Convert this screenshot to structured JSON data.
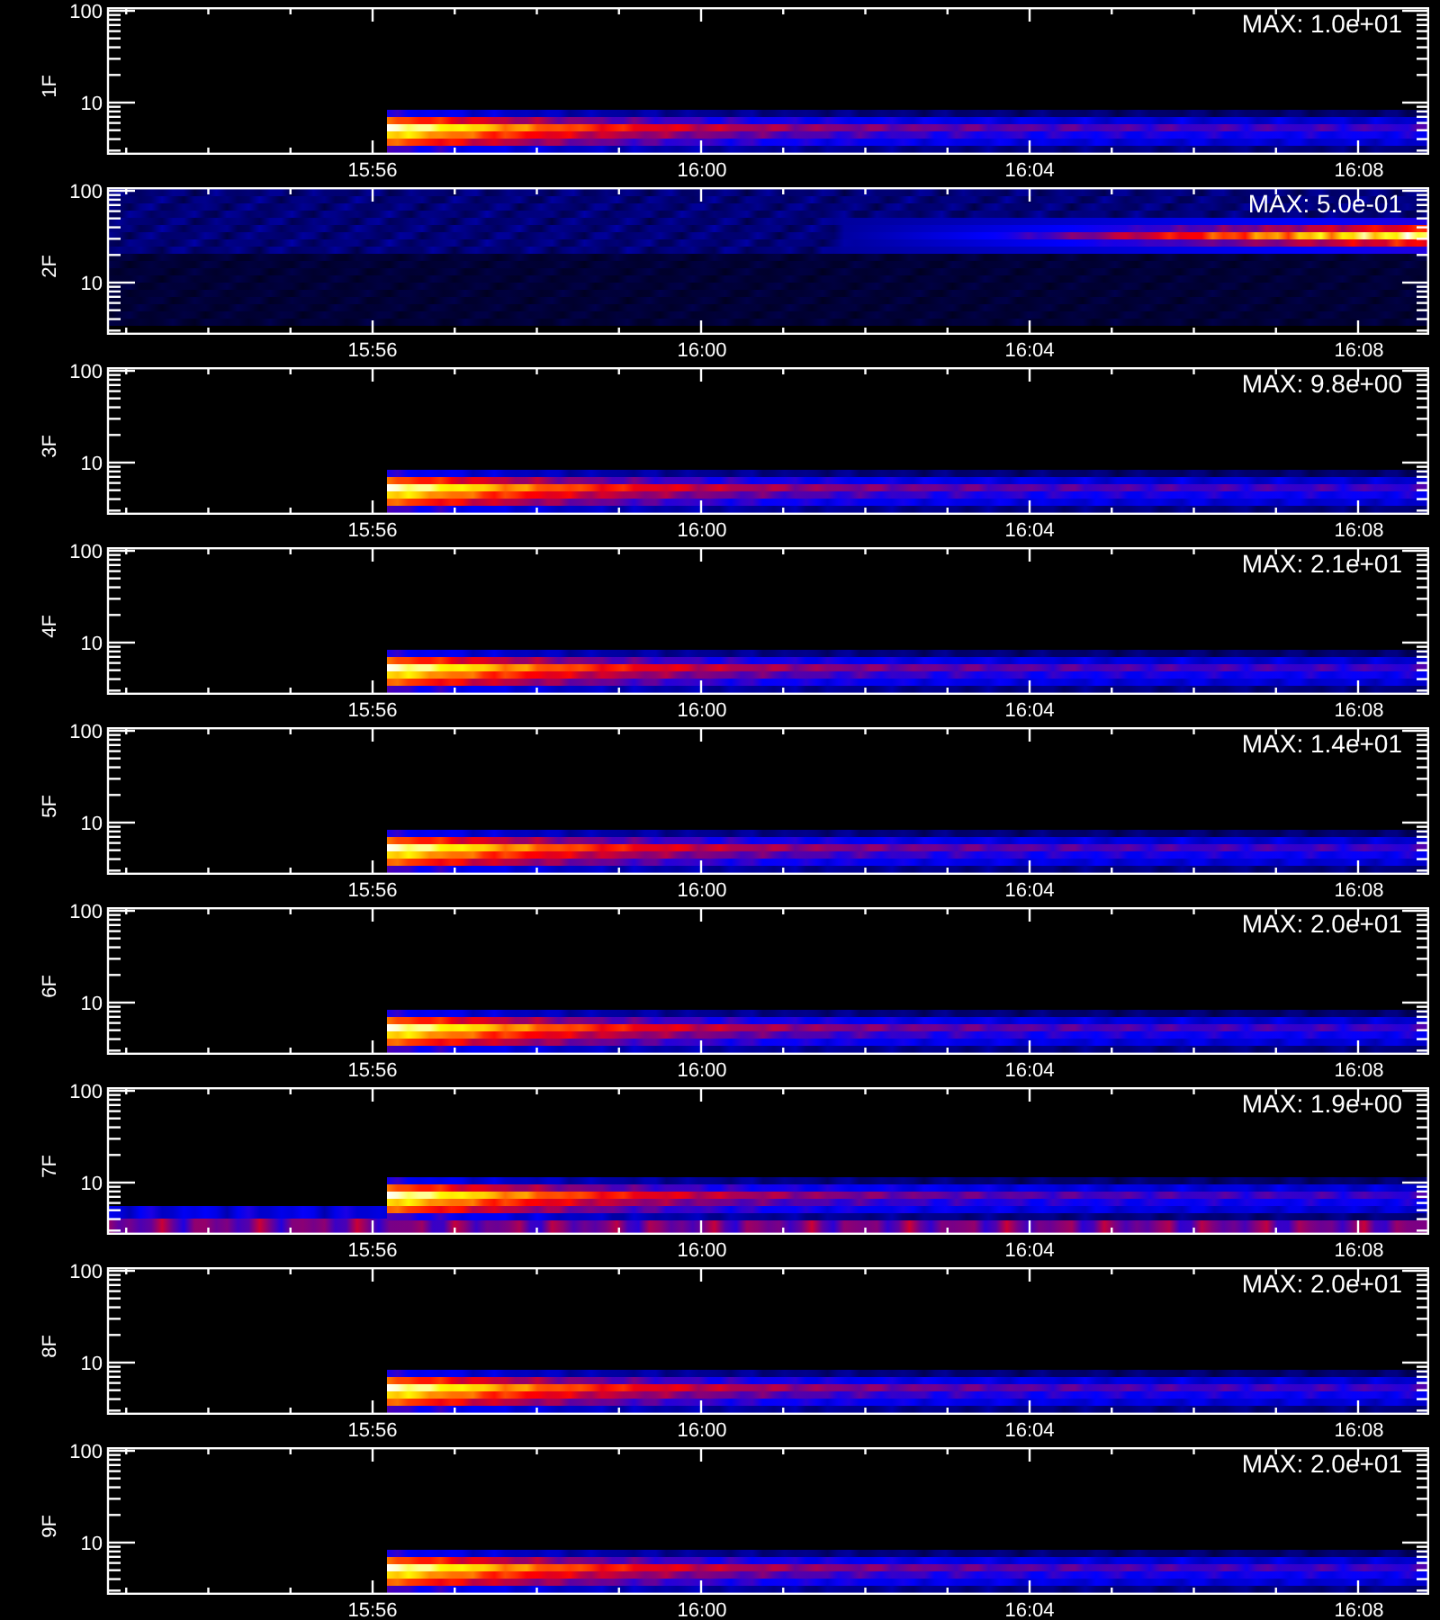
{
  "panels": [
    {
      "label": "1F",
      "kind": "burst",
      "max": "MAX: 1.0e+01",
      "y_ticks": [
        "100",
        "10"
      ],
      "x_ticks": [
        "15:56",
        "16:00",
        "16:04",
        "16:08"
      ]
    },
    {
      "label": "2F",
      "kind": "drift",
      "max": "MAX: 5.0e-01",
      "y_ticks": [
        "100",
        "10"
      ],
      "x_ticks": [
        "15:56",
        "16:00",
        "16:04",
        "16:08"
      ]
    },
    {
      "label": "3F",
      "kind": "burst",
      "max": "MAX: 9.8e+00",
      "y_ticks": [
        "100",
        "10"
      ],
      "x_ticks": [
        "15:56",
        "16:00",
        "16:04",
        "16:08"
      ]
    },
    {
      "label": "4F",
      "kind": "burst",
      "max": "MAX: 2.1e+01",
      "y_ticks": [
        "100",
        "10"
      ],
      "x_ticks": [
        "15:56",
        "16:00",
        "16:04",
        "16:08"
      ]
    },
    {
      "label": "5F",
      "kind": "burst",
      "max": "MAX: 1.4e+01",
      "y_ticks": [
        "100",
        "10"
      ],
      "x_ticks": [
        "15:56",
        "16:00",
        "16:04",
        "16:08"
      ]
    },
    {
      "label": "6F",
      "kind": "burst",
      "max": "MAX: 2.0e+01",
      "y_ticks": [
        "100",
        "10"
      ],
      "x_ticks": [
        "15:56",
        "16:00",
        "16:04",
        "16:08"
      ]
    },
    {
      "label": "7F",
      "kind": "noisy",
      "max": "MAX: 1.9e+00",
      "y_ticks": [
        "100",
        "10"
      ],
      "x_ticks": [
        "15:56",
        "16:00",
        "16:04",
        "16:08"
      ]
    },
    {
      "label": "8F",
      "kind": "burst",
      "max": "MAX: 2.0e+01",
      "y_ticks": [
        "100",
        "10"
      ],
      "x_ticks": [
        "15:56",
        "16:00",
        "16:04",
        "16:08"
      ]
    },
    {
      "label": "9F",
      "kind": "burst",
      "max": "MAX: 2.0e+01",
      "y_ticks": [
        "100",
        "10"
      ],
      "x_ticks": [
        "15:56",
        "16:00",
        "16:04",
        "16:08"
      ]
    }
  ]
}
